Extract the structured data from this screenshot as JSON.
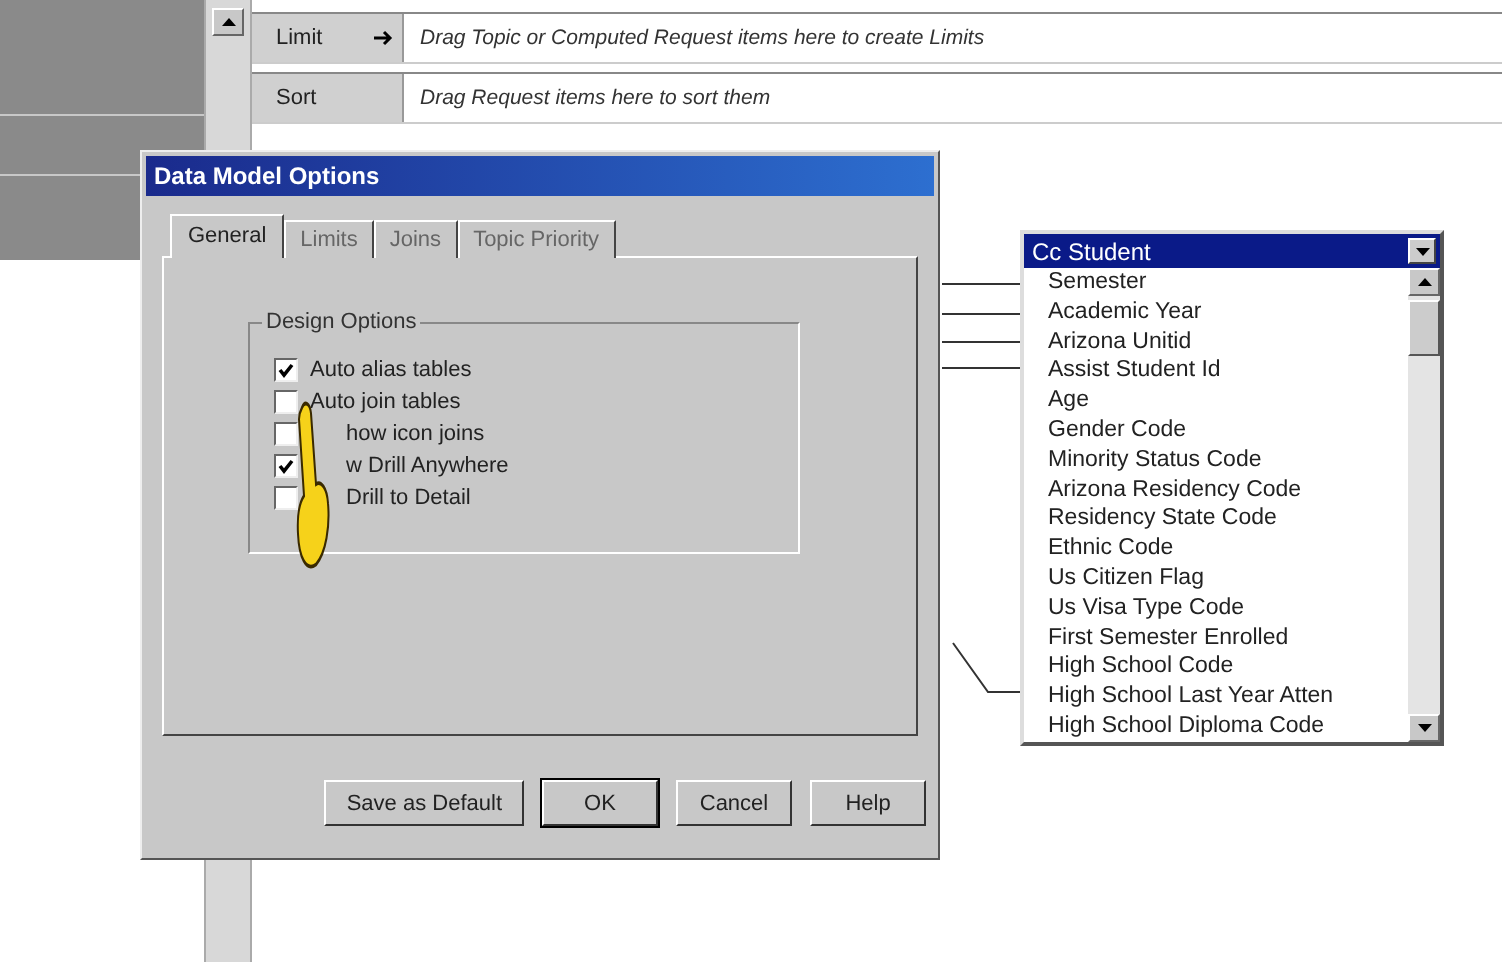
{
  "query_rows": [
    {
      "label": "Limit",
      "has_arrow": true,
      "hint": "Drag Topic or Computed Request items here to create Limits"
    },
    {
      "label": "Sort",
      "has_arrow": false,
      "hint": "Drag Request items here to sort them"
    }
  ],
  "dialog": {
    "title": "Data Model Options",
    "tabs": [
      {
        "label": "General",
        "selected": true
      },
      {
        "label": "Limits",
        "selected": false
      },
      {
        "label": "Joins",
        "selected": false
      },
      {
        "label": "Topic Priority",
        "selected": false
      }
    ],
    "group_title": "Design Options",
    "options": [
      {
        "label": "Auto alias tables",
        "checked": true
      },
      {
        "label": "Auto join tables",
        "checked": false
      },
      {
        "label": "how icon joins",
        "checked": false
      },
      {
        "label": "w Drill Anywhere",
        "checked": true
      },
      {
        "label": "Drill to Detail",
        "checked": false
      }
    ],
    "buttons": [
      {
        "label": "Save as Default",
        "default": false
      },
      {
        "label": "OK",
        "default": true
      },
      {
        "label": "Cancel",
        "default": false
      },
      {
        "label": "Help",
        "default": false
      }
    ]
  },
  "topic": {
    "title": "Cc Student",
    "items": [
      "Semester",
      "Academic Year",
      "Arizona Unitid",
      "Assist Student Id",
      "Age",
      "Gender Code",
      "Minority Status Code",
      "Arizona Residency Code",
      "Residency State Code",
      "Ethnic Code",
      "Us Citizen Flag",
      "Us Visa Type Code",
      "First Semester Enrolled",
      "High School Code",
      "High School Last Year Atten",
      "High School Diploma Code"
    ]
  }
}
